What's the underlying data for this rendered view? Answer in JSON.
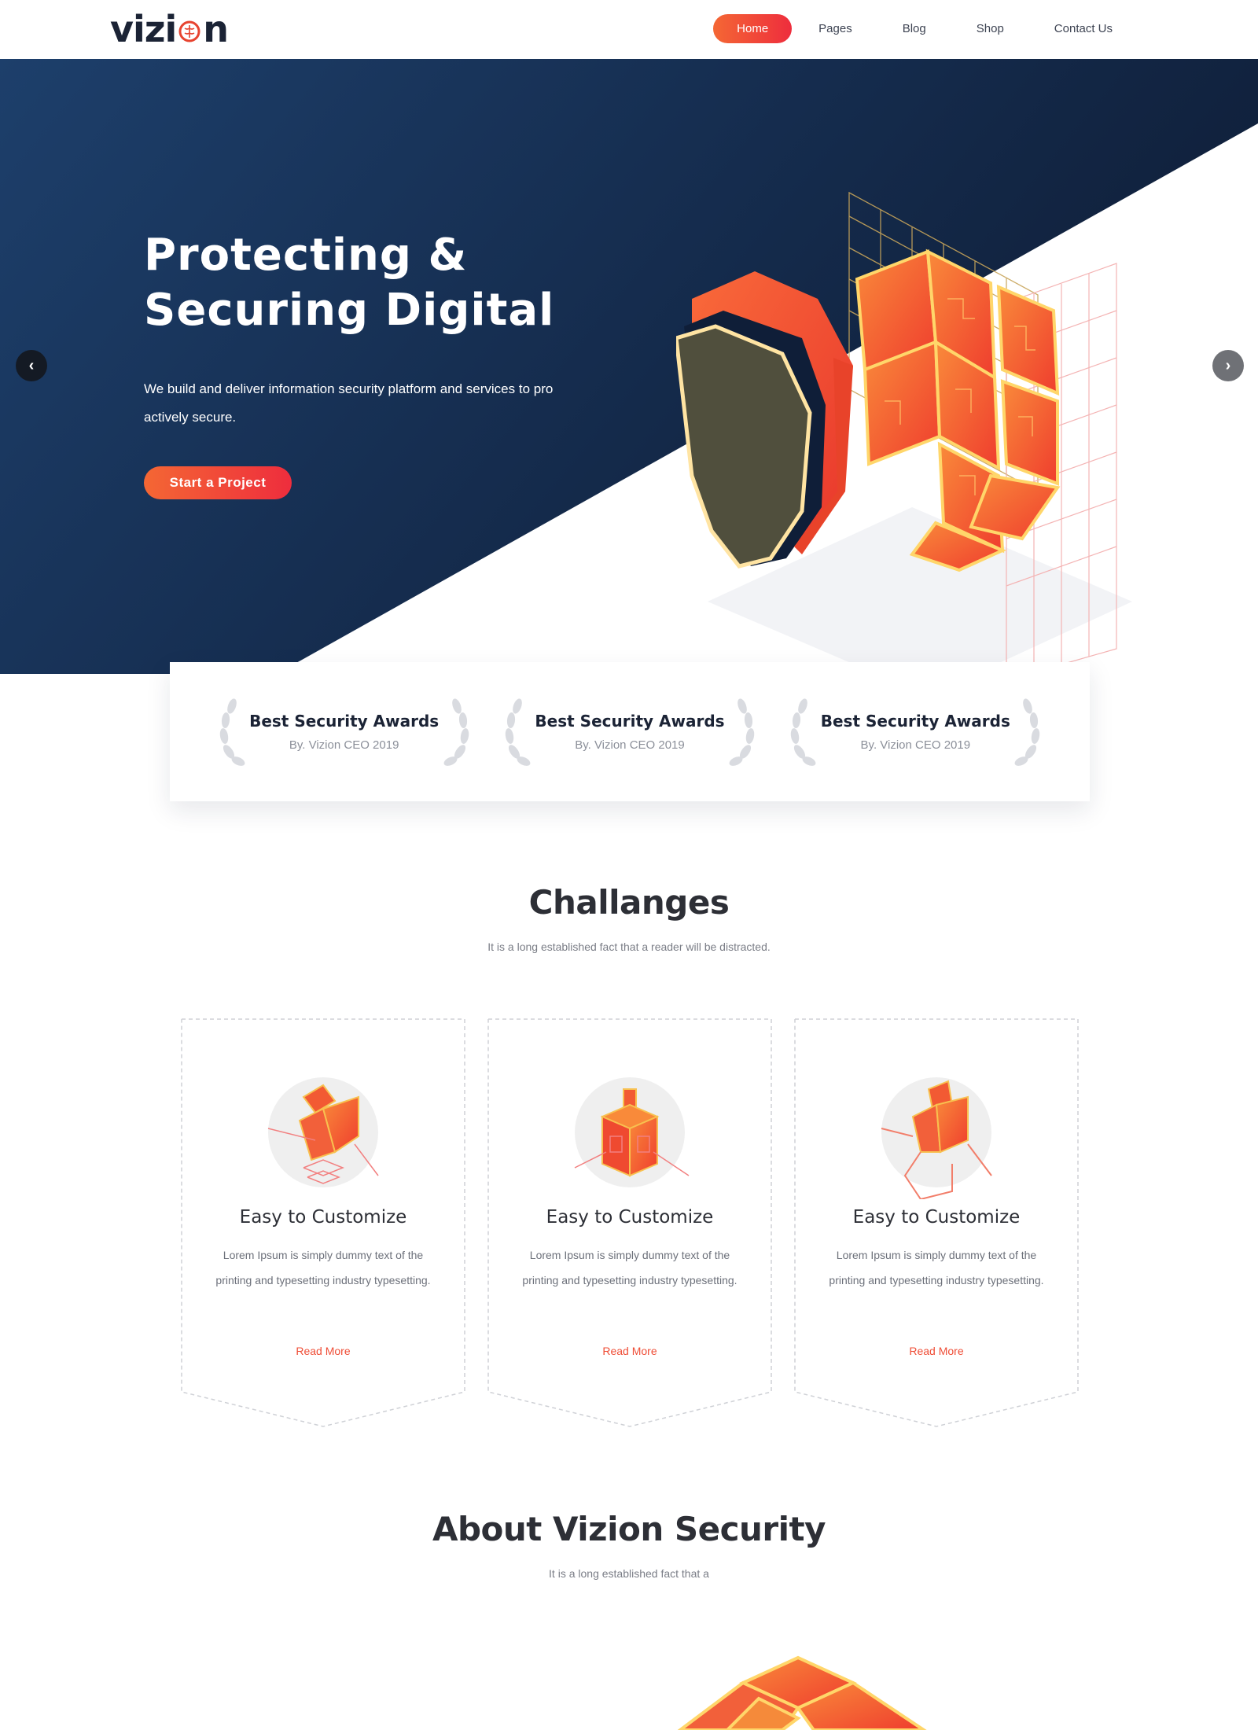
{
  "header": {
    "logo_text_left": "vizi",
    "logo_text_right": "n",
    "nav": [
      {
        "label": "Home",
        "active": true
      },
      {
        "label": "Pages",
        "active": false
      },
      {
        "label": "Blog",
        "active": false
      },
      {
        "label": "Shop",
        "active": false
      },
      {
        "label": "Contact Us",
        "active": false
      }
    ]
  },
  "hero": {
    "title_line1": "Protecting &",
    "title_line2": "Securing Digital",
    "description": "We build and deliver information security platform and services to pro actively secure.",
    "cta_label": "Start a Project",
    "prev_icon": "chevron-left-icon",
    "next_icon": "chevron-right-icon"
  },
  "awards": [
    {
      "title": "Best Security Awards",
      "subtitle": "By. Vizion CEO 2019"
    },
    {
      "title": "Best Security Awards",
      "subtitle": "By. Vizion CEO 2019"
    },
    {
      "title": "Best Security Awards",
      "subtitle": "By. Vizion CEO 2019"
    }
  ],
  "challenges": {
    "title": "Challanges",
    "subtitle": "It is a long established fact that a reader will be distracted.",
    "cards": [
      {
        "title": "Easy to Customize",
        "text": "Lorem Ipsum is simply dummy text of the printing and typesetting industry typesetting.",
        "link": "Read More",
        "icon": "stacked-cube-icon"
      },
      {
        "title": "Easy to Customize",
        "text": "Lorem Ipsum is simply dummy text of the printing and typesetting industry typesetting.",
        "link": "Read More",
        "icon": "server-cube-icon"
      },
      {
        "title": "Easy to Customize",
        "text": "Lorem Ipsum is simply dummy text of the printing and typesetting industry typesetting.",
        "link": "Read More",
        "icon": "connected-cube-icon"
      }
    ]
  },
  "about": {
    "title": "About Vizion Security",
    "subtitle": "It is a long established fact that a"
  },
  "colors": {
    "accent_start": "#f46734",
    "accent_end": "#ee2d3d",
    "hero_dark": "#1b3a63",
    "text_dark": "#1b2335"
  }
}
